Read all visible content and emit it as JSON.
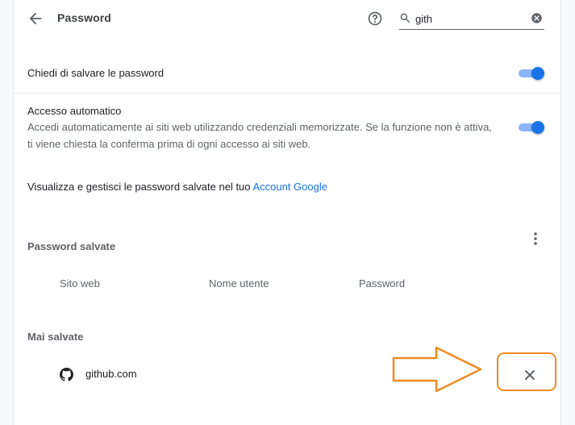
{
  "header": {
    "title": "Password",
    "back_icon": "arrow-back-icon",
    "help_icon": "help-circle-icon"
  },
  "search": {
    "value": "gith",
    "placeholder": "Cerca password",
    "icon": "search-icon",
    "clear_icon": "clear-circle-icon"
  },
  "settings": {
    "offer_to_save": {
      "label": "Chiedi di salvare le password",
      "enabled": true
    },
    "auto_signin": {
      "label": "Accesso automatico",
      "description_line1": "Accedi automaticamente ai siti web utilizzando credenziali memorizzate. Se la funzione non è attiva,",
      "description_line2": "ti viene chiesta la conferma prima di ogni accesso ai siti web.",
      "enabled": true
    },
    "manage": {
      "text": "Visualizza e gestisci le password salvate nel tuo",
      "link": "Account Google"
    }
  },
  "saved_passwords": {
    "title": "Password salvate",
    "menu_icon": "more-vert-icon",
    "columns": [
      "Sito web",
      "Nome utente",
      "Password"
    ]
  },
  "never_saved": {
    "title": "Mai salvate",
    "items": [
      {
        "site": "github.com",
        "icon": "github-icon",
        "remove_icon": "close-icon"
      }
    ]
  },
  "colors": {
    "accent": "#1a73e8",
    "toggle_track": "#8ab4f8",
    "annotation": "#f08a24"
  }
}
